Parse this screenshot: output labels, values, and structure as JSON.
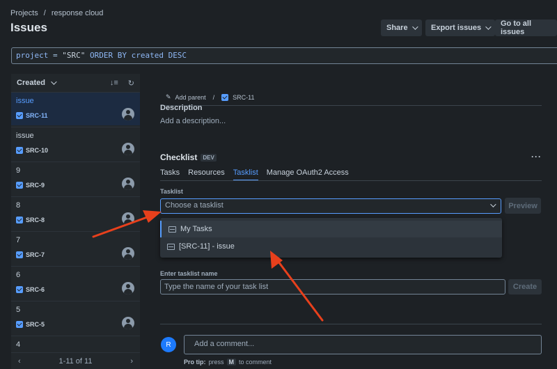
{
  "breadcrumb": {
    "projects": "Projects",
    "separator": "/",
    "project": "response cloud"
  },
  "page_title": "Issues",
  "header_buttons": {
    "share": "Share",
    "export": "Export issues",
    "all": "Go to all issues"
  },
  "jql": {
    "kw1": "project",
    "eq": " = ",
    "value": "\"SRC\"",
    "rest": " ORDER BY created DESC"
  },
  "list": {
    "sort_label": "Created",
    "items": [
      {
        "summary": "issue",
        "key": "SRC-11"
      },
      {
        "summary": "issue",
        "key": "SRC-10"
      },
      {
        "summary": "9",
        "key": "SRC-9"
      },
      {
        "summary": "8",
        "key": "SRC-8"
      },
      {
        "summary": "7",
        "key": "SRC-7"
      },
      {
        "summary": "6",
        "key": "SRC-6"
      },
      {
        "summary": "5",
        "key": "SRC-5"
      },
      {
        "summary": "4",
        "key": ""
      }
    ],
    "pager": "1-11 of 11"
  },
  "detail": {
    "add_parent": "Add parent",
    "sep": "/",
    "key": "SRC-11",
    "description_heading": "Description",
    "description_placeholder": "Add a description...",
    "checklist_title": "Checklist",
    "lozenge": "DEV",
    "more": "···",
    "tabs": [
      "Tasks",
      "Resources",
      "Tasklist",
      "Manage OAuth2 Access"
    ],
    "tasklist_label": "Tasklist",
    "select_placeholder": "Choose a tasklist",
    "preview": "Preview",
    "options": [
      "My Tasks",
      "[SRC-11] - issue"
    ],
    "name_label": "Enter tasklist name",
    "name_placeholder": "Type the name of your task list",
    "create": "Create",
    "avatar_initial": "R",
    "comment_placeholder": "Add a comment...",
    "protip_a": "Pro tip:",
    "protip_b": "press",
    "protip_key": "M",
    "protip_c": "to comment"
  },
  "colors": {
    "accent": "#579dff",
    "arrow": "#e8401c",
    "background": "#1d2125"
  }
}
